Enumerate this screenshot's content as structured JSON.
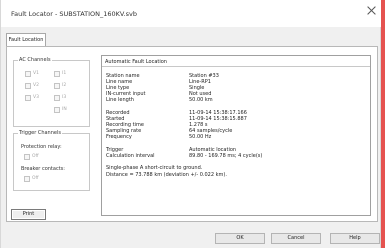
{
  "window": {
    "title": "Fault Locator - SUBSTATION_160KV.svb"
  },
  "tabs": [
    {
      "label": "Fault Location"
    }
  ],
  "ac_channels": {
    "title": "AC Channels",
    "items": [
      {
        "label": "V1",
        "checked": false
      },
      {
        "label": "I1",
        "checked": false
      },
      {
        "label": "V2",
        "checked": false
      },
      {
        "label": "I2",
        "checked": false
      },
      {
        "label": "V3",
        "checked": false
      },
      {
        "label": "I3",
        "checked": false
      },
      {
        "label": "IN",
        "checked": false
      }
    ]
  },
  "trigger_channels": {
    "title": "Trigger Channels",
    "protection_relay": {
      "label": "Protection relay:",
      "option": "Off"
    },
    "breaker_contacts": {
      "label": "Breaker contacts:",
      "option": "Off"
    }
  },
  "print_button": {
    "label": "Print"
  },
  "result": {
    "header": "Automatic Fault Location",
    "rows1": [
      {
        "label": "Station name",
        "value": "Station #33"
      },
      {
        "label": "Line name",
        "value": "Line-RP1"
      },
      {
        "label": "Line type",
        "value": "Single"
      },
      {
        "label": "IN-current input",
        "value": "Not used"
      },
      {
        "label": "Line length",
        "value": "50.00 km"
      }
    ],
    "rows2": [
      {
        "label": "Recorded",
        "value": "11-09-14 15:38:17.166"
      },
      {
        "label": "Started",
        "value": "11-09-14 15:38:15.887"
      },
      {
        "label": "Recording time",
        "value": "1.278 s"
      },
      {
        "label": "Sampling rate",
        "value": "64 samples/cycle"
      },
      {
        "label": "Frequency",
        "value": "50.00 Hz"
      }
    ],
    "rows3": [
      {
        "label": "Trigger",
        "value": "Automatic location"
      },
      {
        "label": "Calculation interval",
        "value": "89.80 - 169.78 ms; 4 cycle(s)"
      }
    ],
    "fault_type": "Single-phase A short-circuit to ground.",
    "distance": "Distance = 73.788 km (deviation +/- 0.022 km)."
  },
  "buttons": {
    "ok": "OK",
    "cancel": "Cancel",
    "help": "Help"
  },
  "colors": {
    "accent_strip": "#e55350"
  }
}
